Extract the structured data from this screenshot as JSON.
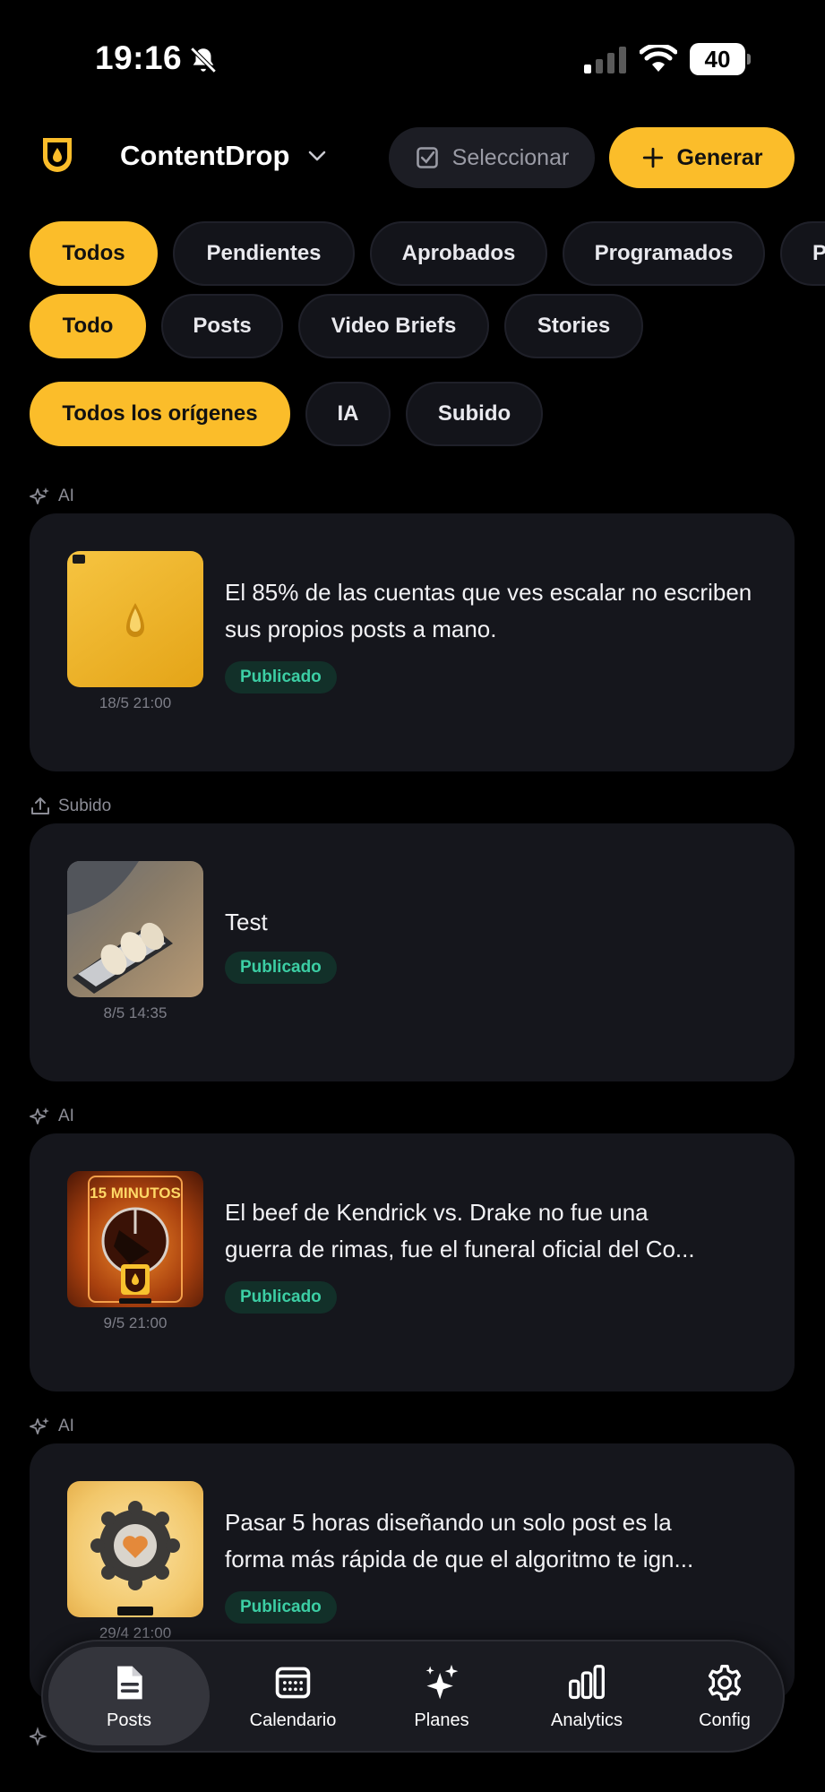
{
  "status_bar": {
    "time": "19:16",
    "battery": "40"
  },
  "header": {
    "app_name": "ContentDrop",
    "select_label": "Seleccionar",
    "generate_label": "Generar"
  },
  "filters": {
    "status": [
      "Todos",
      "Pendientes",
      "Aprobados",
      "Programados",
      "P"
    ],
    "type": [
      "Todo",
      "Posts",
      "Video Briefs",
      "Stories"
    ],
    "origin": [
      "Todos los orígenes",
      "IA",
      "Subido"
    ]
  },
  "posts": [
    {
      "source": "AI",
      "text": "El 85% de las cuentas que ves escalar no escriben sus propios posts a mano.",
      "status": "Publicado",
      "date": "18/5 21:00"
    },
    {
      "source": "Subido",
      "text": "Test",
      "status": "Publicado",
      "date": "8/5 14:35"
    },
    {
      "source": "AI",
      "text_line1": "El beef de Kendrick vs. Drake no fue una",
      "text_line2": "guerra de rimas, fue el funeral oficial del Co...",
      "thumb_text": "15 MINUTOS",
      "status": "Publicado",
      "date": "9/5 21:00"
    },
    {
      "source": "AI",
      "text_line1": "Pasar 5 horas diseñando un solo post es la",
      "text_line2": "forma más rápida de que el algoritmo te ign...",
      "status": "Publicado",
      "date": "29/4 21:00"
    }
  ],
  "nav": {
    "posts": "Posts",
    "calendar": "Calendario",
    "plans": "Planes",
    "analytics": "Analytics",
    "config": "Config"
  },
  "colors": {
    "accent": "#fbbd2a",
    "background": "#000000",
    "card": "#15161c",
    "badge_text": "#3ccea4"
  }
}
